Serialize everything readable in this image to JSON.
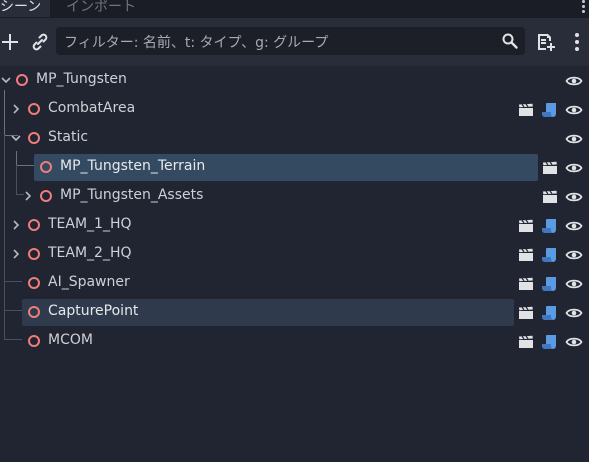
{
  "tabs": {
    "scene": "シーン",
    "import": "インポート"
  },
  "toolbar": {
    "add_icon": "plus-icon",
    "link_icon": "link-icon",
    "filter_placeholder": "フィルター: 名前、t: タイプ、g: グループ",
    "search_icon": "search-icon",
    "script_icon": "add-script-icon",
    "menu_icon": "kebab-menu-icon"
  },
  "tree": {
    "rows": [
      {
        "label": "MP_Tungsten",
        "expanded": true,
        "selected": false,
        "clapper": false,
        "script": false
      },
      {
        "label": "CombatArea",
        "expanded": false,
        "selected": false,
        "clapper": true,
        "script": true
      },
      {
        "label": "Static",
        "expanded": true,
        "selected": false,
        "clapper": false,
        "script": false
      },
      {
        "label": "MP_Tungsten_Terrain",
        "expanded": false,
        "selected": true,
        "clapper": true,
        "script": false
      },
      {
        "label": "MP_Tungsten_Assets",
        "expanded": false,
        "selected": false,
        "clapper": true,
        "script": false
      },
      {
        "label": "TEAM_1_HQ",
        "expanded": false,
        "selected": false,
        "clapper": true,
        "script": true
      },
      {
        "label": "TEAM_2_HQ",
        "expanded": false,
        "selected": false,
        "clapper": true,
        "script": true
      },
      {
        "label": "AI_Spawner",
        "expanded": false,
        "selected": false,
        "clapper": true,
        "script": true
      },
      {
        "label": "CapturePoint",
        "expanded": false,
        "selected": true,
        "clapper": true,
        "script": true
      },
      {
        "label": "MCOM",
        "expanded": false,
        "selected": false,
        "clapper": true,
        "script": true
      }
    ]
  },
  "colors": {
    "node_icon": "#f07c7c",
    "script_icon": "#5b9be3",
    "selection": "#344a60"
  }
}
